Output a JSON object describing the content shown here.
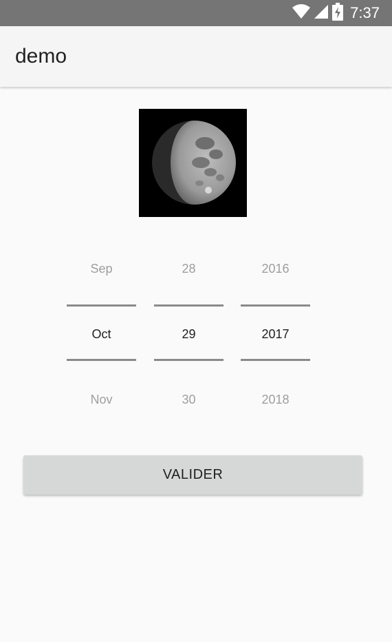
{
  "status_bar": {
    "time": "7:37",
    "icons": [
      "wifi-icon",
      "signal-icon",
      "battery-charging-icon"
    ]
  },
  "app_bar": {
    "title": "demo"
  },
  "moon_image": {
    "icon": "moon-phase-image"
  },
  "date_picker": {
    "month": {
      "prev": "Sep",
      "selected": "Oct",
      "next": "Nov"
    },
    "day": {
      "prev": "28",
      "selected": "29",
      "next": "30"
    },
    "year": {
      "prev": "2016",
      "selected": "2017",
      "next": "2018"
    }
  },
  "actions": {
    "validate_label": "VALIDER"
  },
  "colors": {
    "status_bar": "#757575",
    "app_bar": "#f5f5f5",
    "background": "#fafafa",
    "button": "#d6d7d7",
    "divider": "#8a8a8a"
  }
}
